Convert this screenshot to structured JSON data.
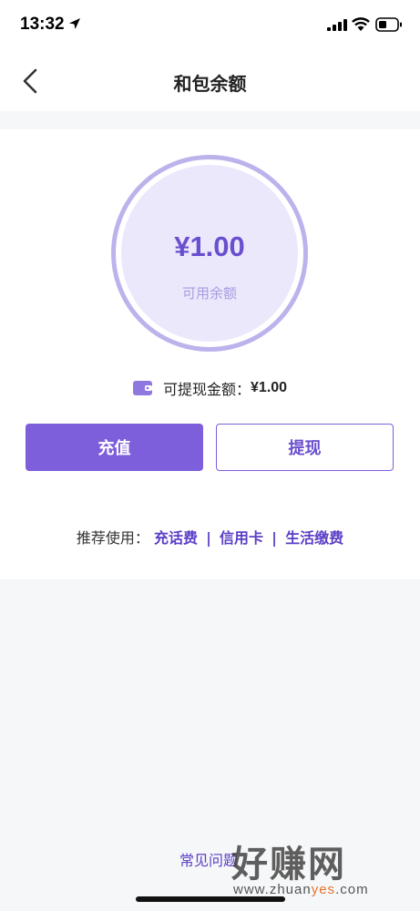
{
  "status_bar": {
    "time": "13:32"
  },
  "nav": {
    "title": "和包余额"
  },
  "balance": {
    "amount": "¥1.00",
    "label": "可用余额"
  },
  "withdrawable": {
    "label": "可提现金额：",
    "value": "¥1.00"
  },
  "buttons": {
    "recharge": "充值",
    "withdraw": "提现"
  },
  "recommend": {
    "label": "推荐使用：",
    "separator": "|",
    "links": [
      "充话费",
      "信用卡",
      "生活缴费"
    ]
  },
  "faq": {
    "label": "常见问题"
  },
  "watermark": {
    "brand": "好赚网",
    "url_prefix": "www.zhuan",
    "url_highlight": "yes",
    "url_suffix": ".com"
  },
  "colors": {
    "accent": "#7d5edb",
    "accent_text": "#6a4fce",
    "ring": "#bcb3ec",
    "disk": "#ebe8fc"
  },
  "icons": {
    "location": "location-arrow-icon",
    "signal": "signal-icon",
    "wifi": "wifi-icon",
    "battery": "battery-icon",
    "back": "chevron-left-icon",
    "wallet": "wallet-icon"
  }
}
